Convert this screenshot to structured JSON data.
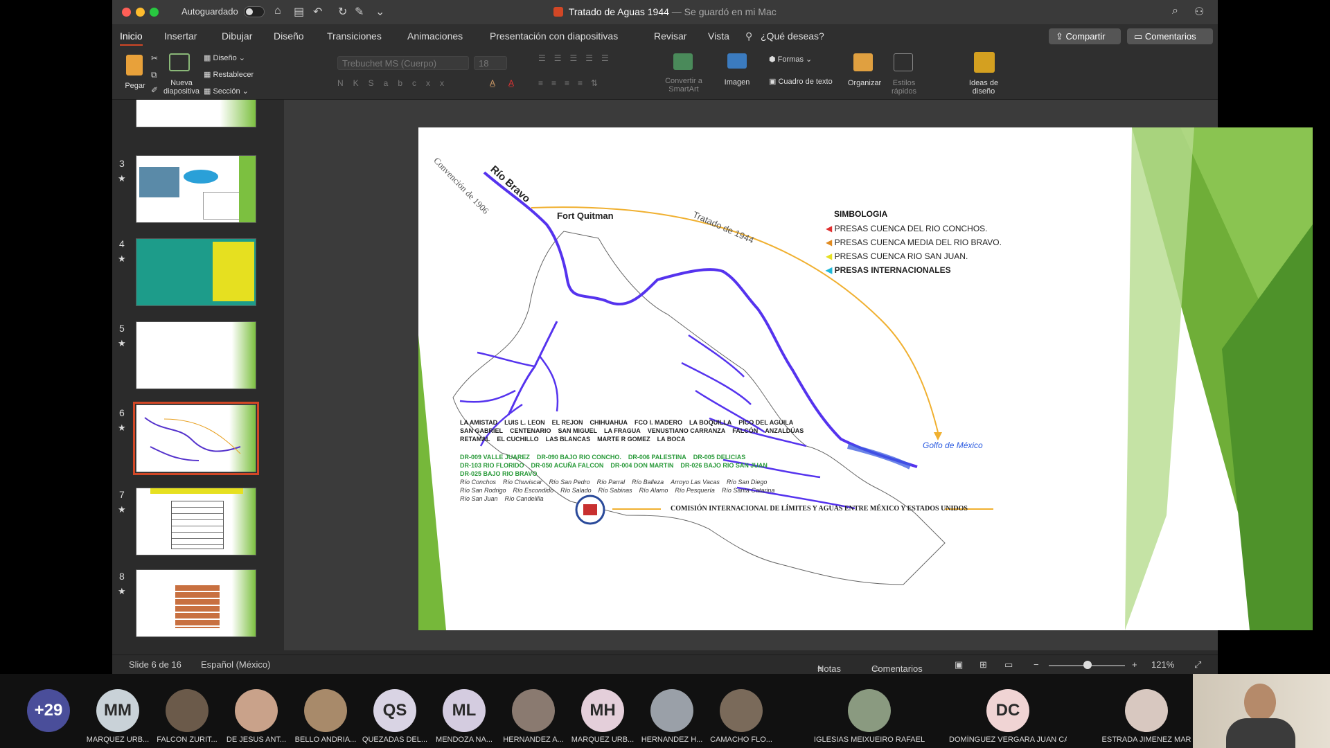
{
  "titlebar": {
    "autosave_label": "Autoguardado",
    "doc_name": "Tratado de Aguas 1944",
    "doc_status": "— Se guardó en mi Mac"
  },
  "tabs": [
    "Inicio",
    "Insertar",
    "Dibujar",
    "Diseño",
    "Transiciones",
    "Animaciones",
    "Presentación con diapositivas",
    "Revisar",
    "Vista",
    "¿Qué deseas?"
  ],
  "buttons": {
    "share": "Compartir",
    "comments": "Comentarios"
  },
  "ribbon": {
    "paste": "Pegar",
    "new_slide": "Nueva diapositiva",
    "layout": "Diseño",
    "reset": "Restablecer",
    "section": "Sección",
    "font": "Trebuchet MS (Cuerpo)",
    "size": "18",
    "smartart": "Convertir a SmartArt",
    "image": "Imagen",
    "shapes": "Formas",
    "textbox": "Cuadro de texto",
    "arrange": "Organizar",
    "quick_styles": "Estilos rápidos",
    "design_ideas": "Ideas de diseño"
  },
  "thumbnails": [
    {
      "num": "3",
      "star": "★"
    },
    {
      "num": "4",
      "star": "★"
    },
    {
      "num": "5",
      "star": "★"
    },
    {
      "num": "6",
      "star": "★"
    },
    {
      "num": "7",
      "star": "★"
    },
    {
      "num": "8",
      "star": "★"
    }
  ],
  "slide": {
    "river_title": "Río Bravo",
    "convention": "Convención de 1906",
    "treaty": "Tratado de 1944",
    "fort": "Fort Quitman",
    "legend_title": "SIMBOLOGIA",
    "legend": [
      {
        "label": "PRESAS CUENCA DEL RIO CONCHOS.",
        "color": "#e03030"
      },
      {
        "label": "PRESAS CUENCA MEDIA DEL RIO BRAVO.",
        "color": "#e08a20"
      },
      {
        "label": "PRESAS CUENCA RIO SAN JUAN.",
        "color": "#e6e020"
      },
      {
        "label": "PRESAS INTERNACIONALES",
        "color": "#20b8d8"
      }
    ],
    "dams": [
      "LA AMISTAD",
      "LUIS L. LEON",
      "EL REJON",
      "CHIHUAHUA",
      "FCO I. MADERO",
      "LA BOQUILLA",
      "PICO DEL AGUILA",
      "SAN GABRIEL",
      "CENTENARIO",
      "SAN MIGUEL",
      "LA FRAGUA",
      "VENUSTIANO CARRANZA",
      "FALCÓN",
      "ANZALDÚAS",
      "RETAMAL",
      "EL CUCHILLO",
      "LAS BLANCAS",
      "MARTE R GOMEZ",
      "LA BOCA"
    ],
    "districts": [
      "DR-009 VALLE JUAREZ",
      "DR-090 BAJO RIO CONCHO.",
      "DR-006 PALESTINA",
      "DR-005 DELICIAS",
      "DR-103 RIO FLORIDO",
      "DR-050 ACUÑA FALCON",
      "DR-004 DON MARTIN",
      "DR-026 BAJO RIO SAN JUAN",
      "DR-025 BAJO RIO BRAVO"
    ],
    "rivers": [
      "Río Conchos",
      "Río Chuviscar",
      "Río San Pedro",
      "Río Parral",
      "Río Balleza",
      "Arroyo Las Vacas",
      "Río San Diego",
      "Río San Rodrigo",
      "Río Escondido",
      "Río Salado",
      "Río Sabinas",
      "Río Alamo",
      "Río Pesquería",
      "Río Santa Catarina",
      "Río San Juan",
      "Río Candelilla"
    ],
    "gulf": "Golfo de México",
    "commission": "COMISIÓN INTERNACIONAL DE LÍMITES Y AGUAS ENTRE MÉXICO Y ESTADOS UNIDOS"
  },
  "status": {
    "slide_of": "Slide 6 de 16",
    "language": "Español (México)",
    "notes": "Notas",
    "comments": "Comentarios",
    "zoom": "121%"
  },
  "participants": [
    {
      "initials": "+29",
      "name": "",
      "color": "#4a4e9a"
    },
    {
      "initials": "MM",
      "name": "MARQUEZ URB...",
      "color": "#c9d2d8"
    },
    {
      "initials": "",
      "name": "FALCON ZURIT...",
      "color": "#6b5a4a"
    },
    {
      "initials": "",
      "name": "DE JESUS ANT...",
      "color": "#c9a28a"
    },
    {
      "initials": "",
      "name": "BELLO ANDRIA...",
      "color": "#a88a6a"
    },
    {
      "initials": "QS",
      "name": "QUEZADAS DEL...",
      "color": "#d9d4e4"
    },
    {
      "initials": "ML",
      "name": "MENDOZA NA...",
      "color": "#d4cce0"
    },
    {
      "initials": "",
      "name": "HERNANDEZ A...",
      "color": "#8a7a70"
    },
    {
      "initials": "MH",
      "name": "MARQUEZ URB...",
      "color": "#e4cfda"
    },
    {
      "initials": "",
      "name": "HERNANDEZ H...",
      "color": "#9aa0a8"
    },
    {
      "initials": "",
      "name": "CAMACHO FLO...",
      "color": "#7a6a5a"
    },
    {
      "initials": "",
      "name": "IGLESIAS MEIXUEIRO RAFAEL",
      "color": "#8a9a80"
    },
    {
      "initials": "DC",
      "name": "DOMÍNGUEZ VERGARA JUAN CARL...",
      "color": "#f0d4d4"
    },
    {
      "initials": "",
      "name": "ESTRADA JIMENEZ MAR",
      "color": "#d8c8c0"
    }
  ]
}
